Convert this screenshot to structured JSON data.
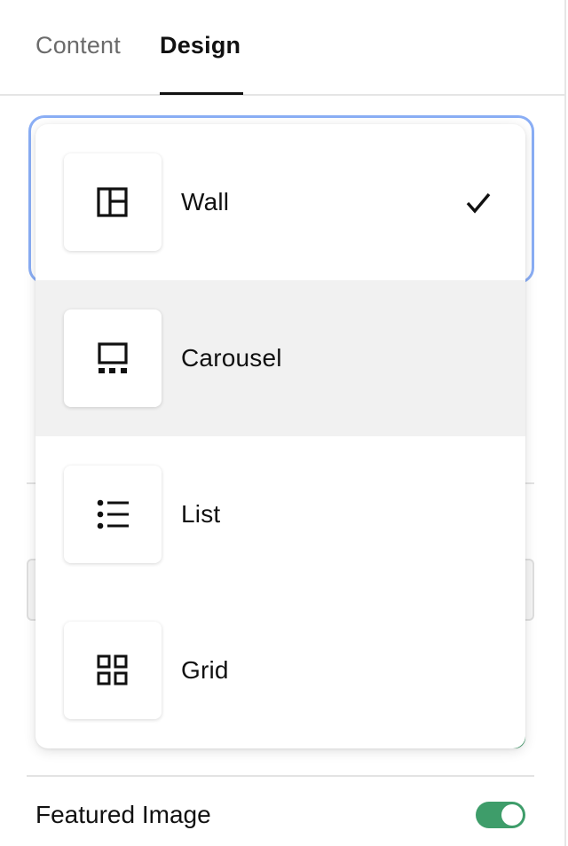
{
  "tabs": {
    "content_label": "Content",
    "design_label": "Design",
    "active": "Design"
  },
  "dropdown": {
    "options": [
      {
        "label": "Wall",
        "icon": "wall-layout-icon",
        "selected": true
      },
      {
        "label": "Carousel",
        "icon": "carousel-layout-icon",
        "hovered": true
      },
      {
        "label": "List",
        "icon": "list-layout-icon"
      },
      {
        "label": "Grid",
        "icon": "grid-layout-icon"
      }
    ]
  },
  "featured_image": {
    "label": "Featured Image",
    "enabled": true
  },
  "colors": {
    "accent_focus": "#8aaef5",
    "toggle_on": "#3e9d6a",
    "hover_bg": "#f1f1f1"
  }
}
